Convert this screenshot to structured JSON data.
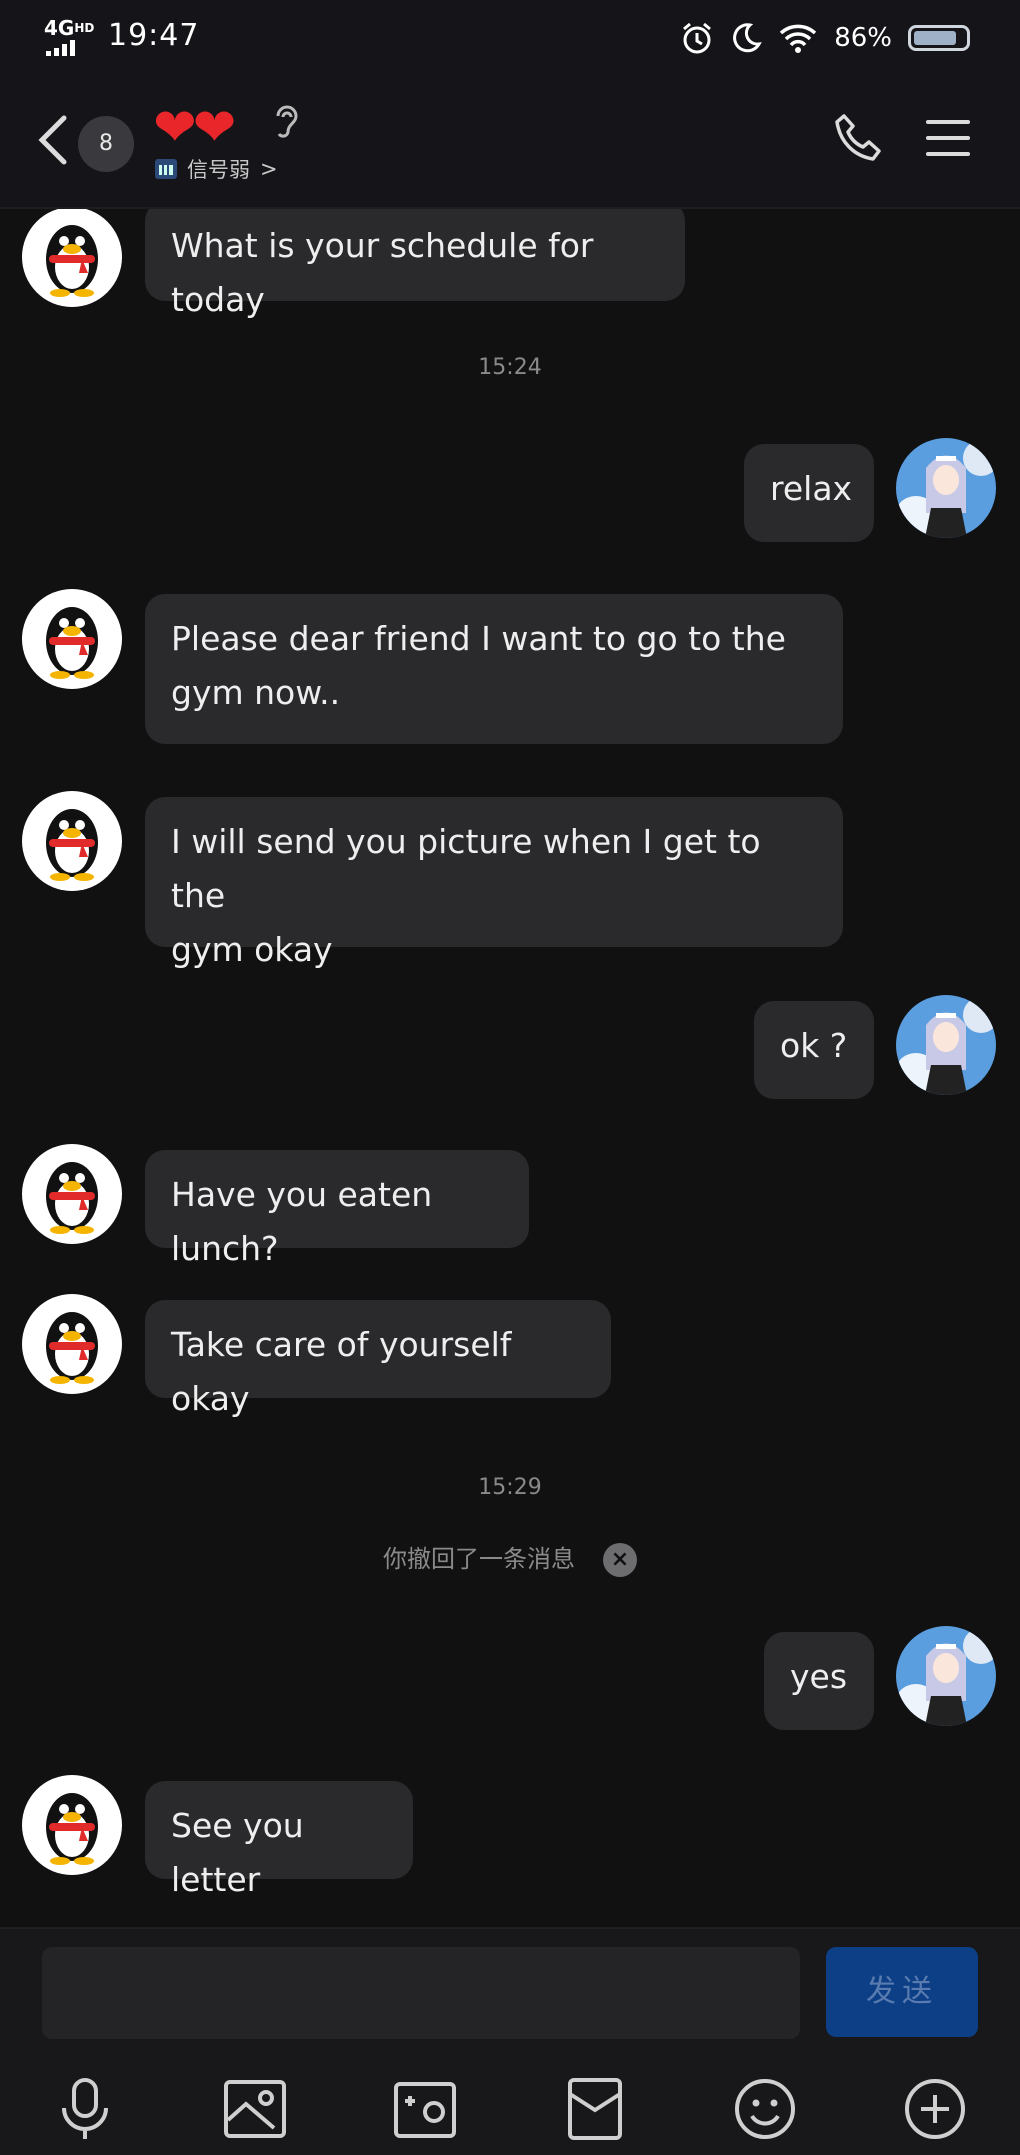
{
  "status_bar": {
    "network": "4G",
    "network_hd": "HD",
    "time": "19:47",
    "battery": "86%"
  },
  "header": {
    "unread_count": "8",
    "title_emoji": "❤❤",
    "subtitle": "信号弱",
    "subtitle_chevron": ">"
  },
  "messages": [
    {
      "side": "left",
      "text": "What is your schedule for today"
    },
    {
      "type": "time",
      "text": "15:24"
    },
    {
      "side": "right",
      "text": "relax"
    },
    {
      "side": "left",
      "lines": [
        "Please dear friend I want to go to the",
        "gym now.."
      ]
    },
    {
      "side": "left",
      "lines": [
        "I will send you picture when I get to the",
        "gym okay"
      ]
    },
    {
      "side": "right",
      "text": "ok ?"
    },
    {
      "side": "left",
      "text": "Have you eaten lunch?"
    },
    {
      "side": "left",
      "text": "Take care of yourself okay"
    },
    {
      "type": "time",
      "text": "15:29"
    },
    {
      "type": "recall",
      "text": "你撤回了一条消息",
      "close": "×"
    },
    {
      "side": "right",
      "text": "yes"
    },
    {
      "side": "left",
      "text": "See you letter"
    }
  ],
  "composer": {
    "input_value": "",
    "send_label": "发送"
  },
  "toolbar": {
    "icons": [
      "microphone-icon",
      "image-icon",
      "camera-icon",
      "red-packet-icon",
      "emoji-icon",
      "plus-icon"
    ]
  },
  "colors": {
    "background": "#111112",
    "bubble": "#2a2a2d",
    "send_button": "#0d3f86",
    "heart": "#e9262a"
  }
}
